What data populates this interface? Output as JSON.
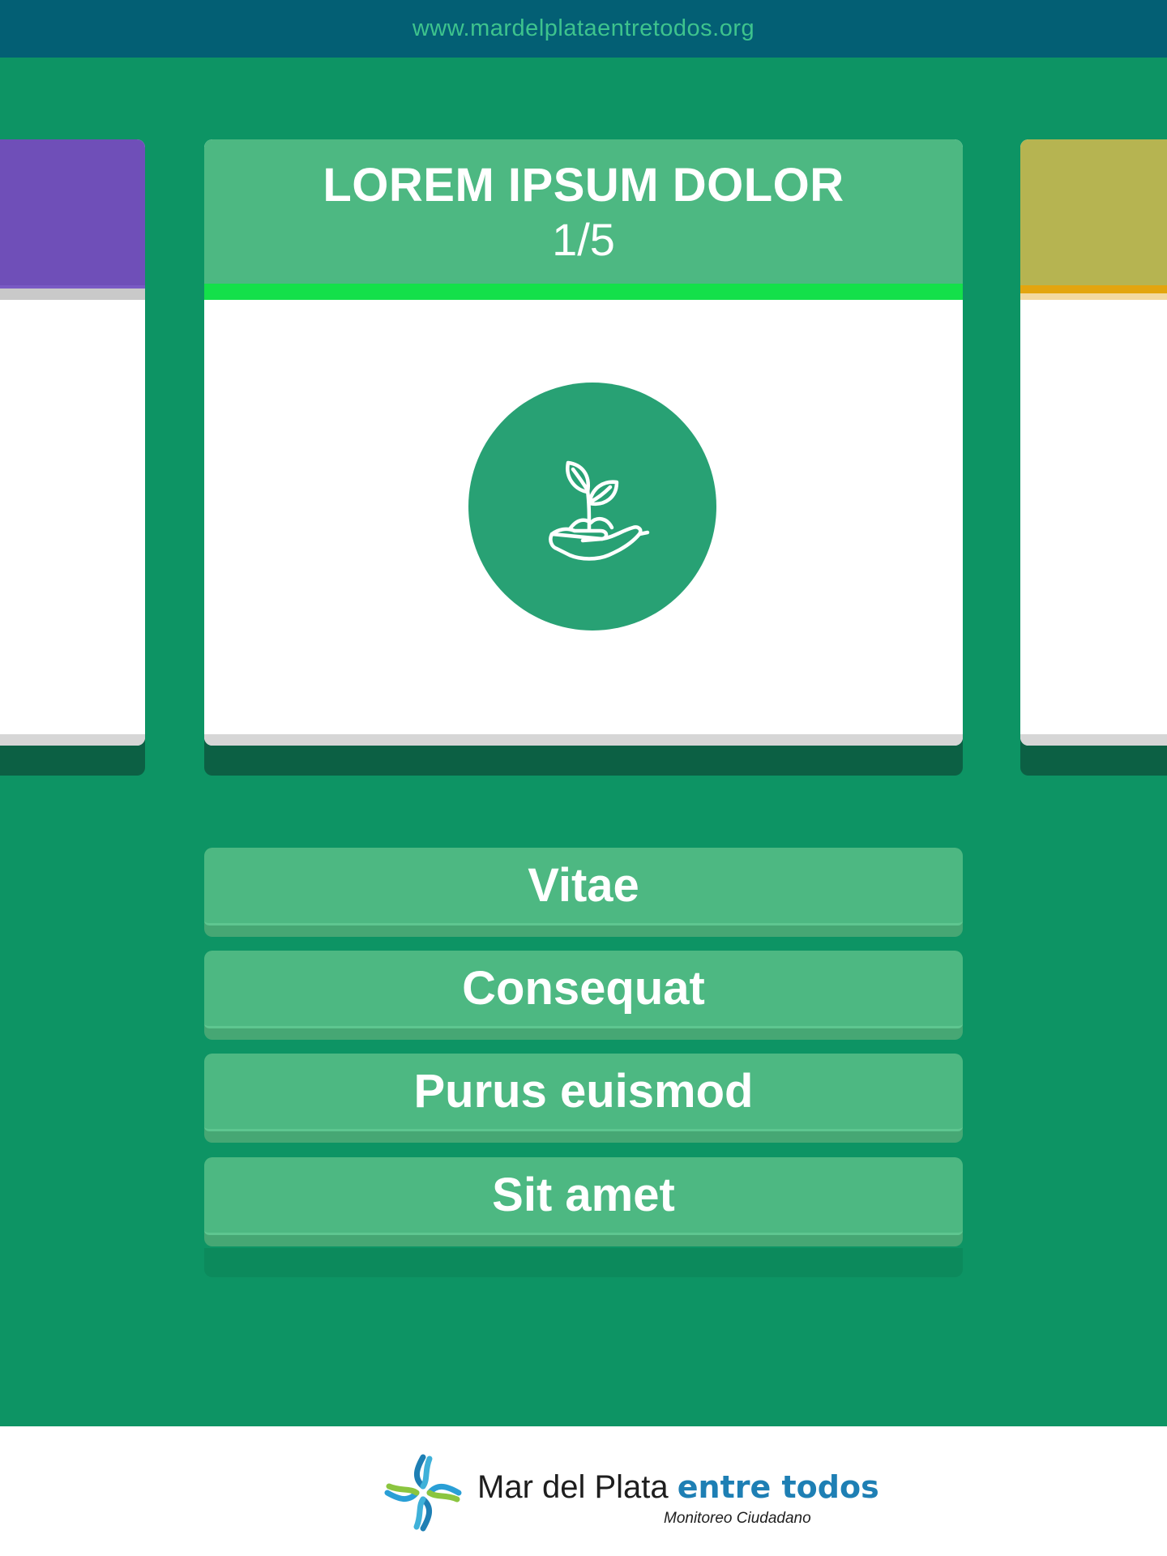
{
  "header": {
    "url": "www.mardelplataentretodos.org"
  },
  "card": {
    "title": "LOREM IPSUM DOLOR",
    "counter": "1/5",
    "progress_fraction": 1.0,
    "icon": "hand-plant-icon",
    "head_color": "#4db882",
    "circle_color": "#28a174"
  },
  "side_cards": {
    "left_color": "#6f4fb8",
    "right_color": "#b6b451",
    "right_accent": "#e3a50e"
  },
  "answers": [
    {
      "label": "Vitae"
    },
    {
      "label": "Consequat"
    },
    {
      "label": "Purus euismod"
    },
    {
      "label": "Sit amet"
    }
  ],
  "footer": {
    "logo_name": "Mar del Plata ",
    "logo_brand": "entre todos",
    "logo_sub": "Monitoreo Ciudadano",
    "logo_icon": "star-cross-logo-icon"
  },
  "colors": {
    "background": "#0d9464",
    "top_bar": "#035f74",
    "url_text": "#3ec38d",
    "progress": "#14e04a"
  }
}
